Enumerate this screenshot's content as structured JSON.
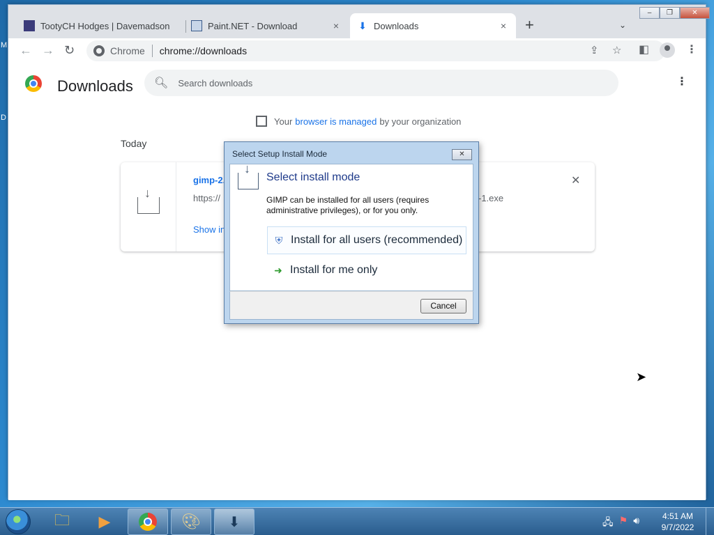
{
  "desktop": {
    "label_left_top": "M",
    "label_left_mid": "D"
  },
  "browser": {
    "tabs": [
      {
        "title": "TootyCH Hodges | Davemadson",
        "close": "×"
      },
      {
        "title": "Paint.NET - Download",
        "close": "×"
      },
      {
        "title": "Downloads",
        "close": "×"
      }
    ],
    "new_tab": "+",
    "tab_list": "⌄",
    "window_controls": {
      "minimize": "–",
      "restore": "❐",
      "close": "✕"
    },
    "nav": {
      "back": "←",
      "forward": "→",
      "reload": "↻"
    },
    "omnibox": {
      "scheme_chip": "Chrome",
      "url": "chrome://downloads"
    }
  },
  "page": {
    "title": "Downloads",
    "search_placeholder": "Search downloads",
    "managed_prefix": "Your",
    "managed_link": "browser is managed",
    "managed_suffix": "by your organization",
    "section_label": "Today",
    "download": {
      "file_name": "gimp-2.",
      "url_prefix": "https://",
      "url_suffix": "-1.exe",
      "show_in_folder": "Show in"
    }
  },
  "dialog": {
    "title": "Select Setup Install Mode",
    "close": "✕",
    "heading": "Select install mode",
    "description": "GIMP can be installed for all users (requires administrative privileges), or for you only.",
    "option_all_users": "Install for all users (recommended)",
    "option_me_only": "Install for me only",
    "cancel": "Cancel"
  },
  "taskbar": {
    "time": "4:51 AM",
    "date": "9/7/2022"
  }
}
